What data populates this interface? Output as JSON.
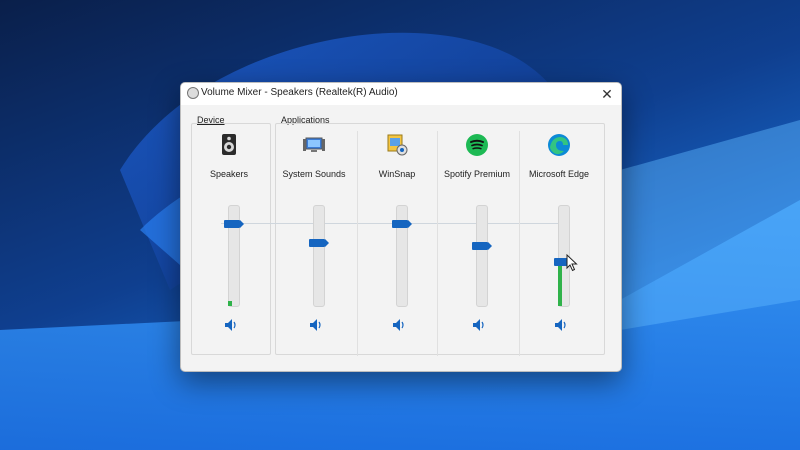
{
  "window": {
    "title": "Volume Mixer - Speakers (Realtek(R) Audio)",
    "close_glyph": "✕"
  },
  "sections": {
    "device": "Device",
    "applications": "Applications"
  },
  "device": {
    "name": "Speakers",
    "icon": "speaker-device-icon",
    "volume": 0.82,
    "peak_level": 0.05,
    "mute_icon": "speaker-volume-icon"
  },
  "applications": [
    {
      "name": "System Sounds",
      "icon": "system-sounds-icon",
      "volume": 0.63,
      "peak_level": 0,
      "mute_icon": "speaker-volume-icon"
    },
    {
      "name": "WinSnap",
      "icon": "winsnap-icon",
      "volume": 0.82,
      "peak_level": 0,
      "mute_icon": "speaker-volume-icon"
    },
    {
      "name": "Spotify Premium",
      "icon": "spotify-icon",
      "volume": 0.6,
      "peak_level": 0,
      "mute_icon": "speaker-volume-icon"
    },
    {
      "name": "Microsoft Edge",
      "icon": "edge-icon",
      "volume": 0.44,
      "peak_level": 0.44,
      "mute_icon": "speaker-volume-icon"
    }
  ],
  "colors": {
    "accent": "#1565c0",
    "meter": "#2fb24a"
  }
}
